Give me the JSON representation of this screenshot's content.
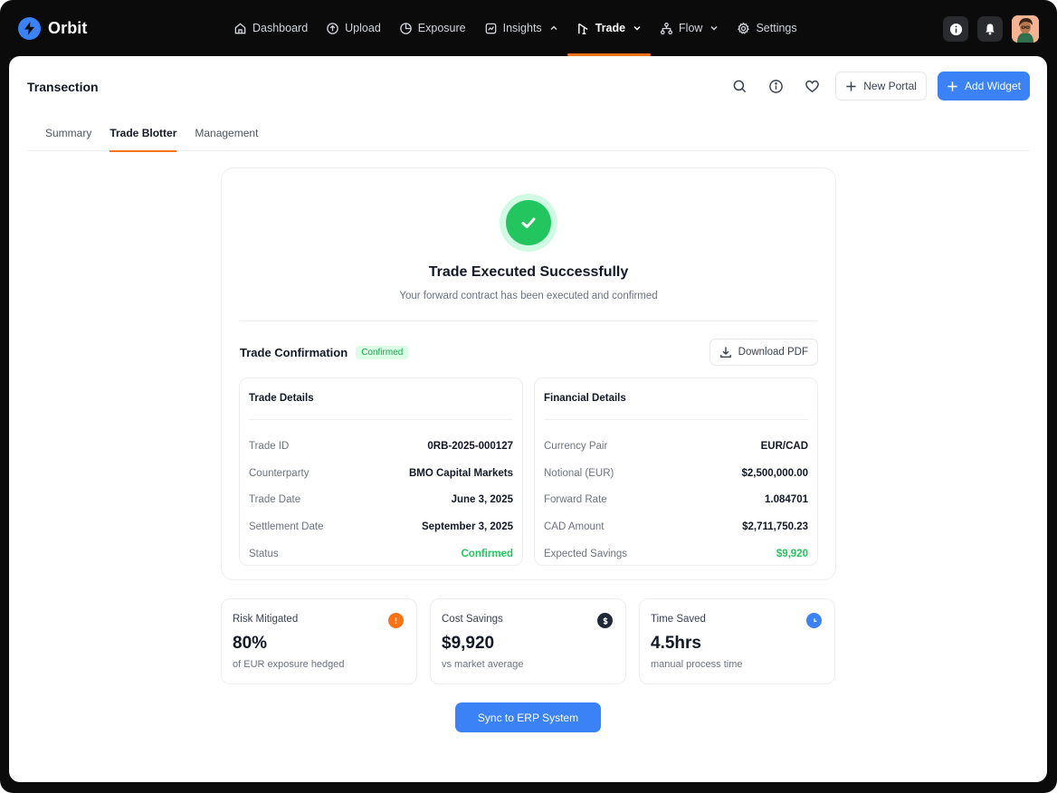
{
  "brand": {
    "name": "Orbit"
  },
  "nav": {
    "items": [
      {
        "label": "Dashboard",
        "icon": "home-icon"
      },
      {
        "label": "Upload",
        "icon": "upload-icon"
      },
      {
        "label": "Exposure",
        "icon": "pie-chart-icon"
      },
      {
        "label": "Insights",
        "icon": "insights-icon",
        "chevron": "up"
      },
      {
        "label": "Trade",
        "icon": "trade-icon",
        "chevron": "down",
        "active": true
      },
      {
        "label": "Flow",
        "icon": "flow-icon",
        "chevron": "down"
      },
      {
        "label": "Settings",
        "icon": "gear-icon"
      }
    ]
  },
  "page": {
    "title": "Transection",
    "new_portal_label": "New Portal",
    "add_widget_label": "Add Widget"
  },
  "tabs": [
    {
      "label": "Summary"
    },
    {
      "label": "Trade Blotter",
      "active": true
    },
    {
      "label": "Management"
    }
  ],
  "confirmation": {
    "title": "Trade Executed Successfully",
    "subtitle": "Your forward contract has been executed and confirmed",
    "section_title": "Trade Confirmation",
    "badge": "Confirmed",
    "download_label": "Download PDF",
    "trade_details": {
      "title": "Trade Details",
      "rows": [
        {
          "label": "Trade ID",
          "value": "0RB-2025-000127"
        },
        {
          "label": "Counterparty",
          "value": "BMO Capital Markets"
        },
        {
          "label": "Trade Date",
          "value": "June 3, 2025"
        },
        {
          "label": "Settlement Date",
          "value": "September 3, 2025"
        },
        {
          "label": "Status",
          "value": "Confirmed"
        }
      ]
    },
    "financial_details": {
      "title": "Financial Details",
      "rows": [
        {
          "label": "Currency Pair",
          "value": "EUR/CAD"
        },
        {
          "label": "Notional (EUR)",
          "value": "$2,500,000.00"
        },
        {
          "label": "Forward Rate",
          "value": "1.084701"
        },
        {
          "label": "CAD Amount",
          "value": "$2,711,750.23"
        },
        {
          "label": "Expected Savings",
          "value": "$9,920"
        }
      ]
    }
  },
  "stats": [
    {
      "label": "Risk Mitigated",
      "value": "80%",
      "sub": "of EUR exposure hedged",
      "icon": "alert-icon",
      "color": "#f97316"
    },
    {
      "label": "Cost Savings",
      "value": "$9,920",
      "sub": "vs market average",
      "icon": "dollar-icon",
      "color": "#1f2937"
    },
    {
      "label": "Time Saved",
      "value": "4.5hrs",
      "sub": "manual process time",
      "icon": "clock-icon",
      "color": "#3b82f6"
    }
  ],
  "sync_label": "Sync to ERP System",
  "colors": {
    "accent": "#3b82f6",
    "active_tab": "#f97316",
    "success": "#22c55e"
  }
}
